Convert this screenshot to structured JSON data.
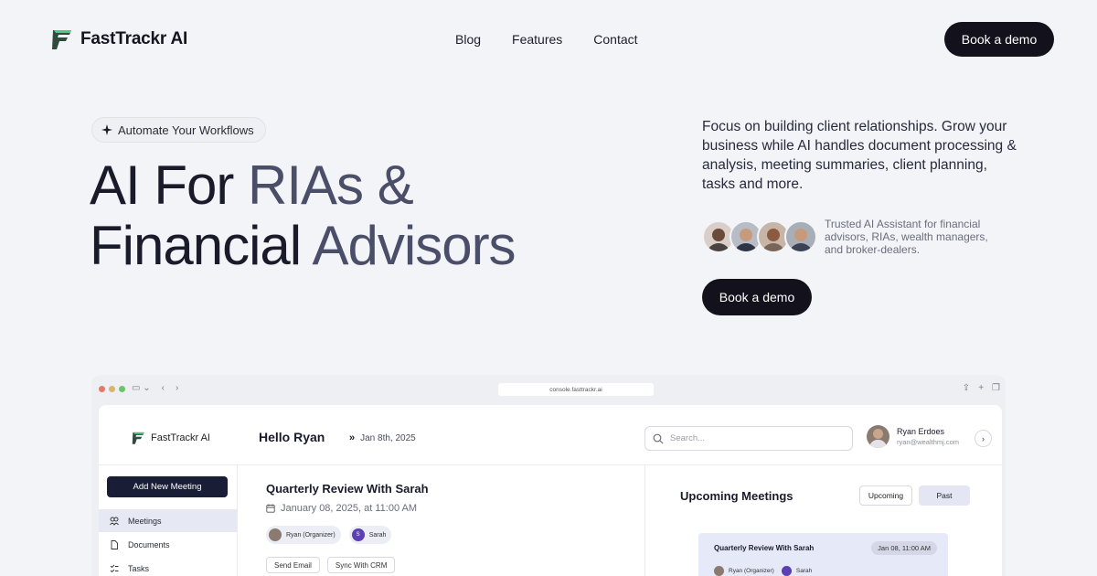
{
  "nav": {
    "brand": "FastTrackr AI",
    "links": [
      "Blog",
      "Features",
      "Contact"
    ],
    "cta": "Book a demo"
  },
  "hero": {
    "pill": "Automate Your Workflows",
    "title_line1_a": "AI For ",
    "title_line1_b": "RIAs &",
    "title_line2_a": "Financial ",
    "title_line2_b": "Advisors",
    "description": "Focus on building client relationships. Grow your business while AI handles document processing & analysis, meeting summaries, client planning, tasks and more.",
    "trust": "Trusted AI Assistant for financial advisors, RIAs, wealth managers, and broker-dealers.",
    "cta": "Book a demo"
  },
  "browser": {
    "url": "console.fasttrackr.ai"
  },
  "app": {
    "brand": "FastTrackr AI",
    "greeting": "Hello Ryan",
    "date": "Jan 8th, 2025",
    "search_placeholder": "Search...",
    "user": {
      "name": "Ryan Erdoes",
      "email": "ryan@wealthmj.com"
    },
    "sidebar": {
      "add_button": "Add New Meeting",
      "items": [
        {
          "label": "Meetings",
          "icon": "meetings-icon",
          "active": true
        },
        {
          "label": "Documents",
          "icon": "documents-icon",
          "active": false
        },
        {
          "label": "Tasks",
          "icon": "tasks-icon",
          "active": false
        }
      ]
    },
    "meeting": {
      "title": "Quarterly Review With Sarah",
      "date": "January 08, 2025, at 11:00 AM",
      "attendees": [
        {
          "name": "Ryan (Organizer)"
        },
        {
          "name": "Sarah",
          "initial": "S"
        }
      ],
      "actions": [
        "Send Email",
        "Sync With CRM"
      ]
    },
    "upcoming": {
      "title": "Upcoming Meetings",
      "tabs": [
        "Upcoming",
        "Past"
      ],
      "card": {
        "title": "Quarterly Review With Sarah",
        "date": "Jan 08, 11:00 AM",
        "attendees": [
          "Ryan (Organizer)",
          "Sarah"
        ]
      }
    }
  },
  "colors": {
    "background": "#f3f4f8",
    "dark": "#12111c",
    "navy": "#1a1d36",
    "active": "#e6e8f3"
  }
}
